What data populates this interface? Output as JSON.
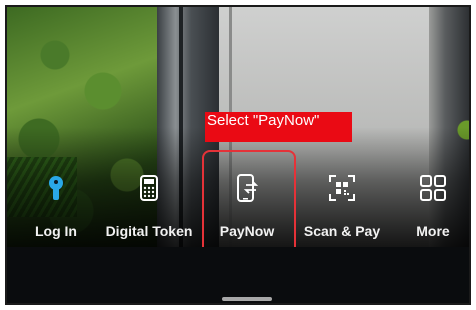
{
  "annotation": {
    "text": "Select \"PayNow\"",
    "color": "#ea0a14",
    "highlight_color": "#e53238"
  },
  "actions": [
    {
      "label": "Log In",
      "icon": "keyhole-icon",
      "color": "#2aa8e8"
    },
    {
      "label": "Digital Token",
      "icon": "token-device-icon"
    },
    {
      "label": "PayNow",
      "icon": "phone-transfer-icon"
    },
    {
      "label": "Scan & Pay",
      "icon": "qr-scan-icon"
    },
    {
      "label": "More",
      "icon": "grid-icon"
    }
  ]
}
